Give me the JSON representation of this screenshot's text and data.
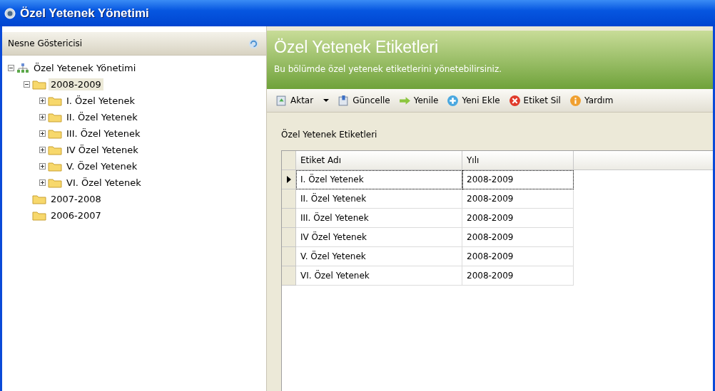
{
  "window": {
    "title": "Özel Yetenek Yönetimi"
  },
  "explorer": {
    "title": "Nesne Göstericisi",
    "tree": [
      {
        "label": "Özel Yetenek Yönetimi",
        "kind": "root",
        "expanded": true,
        "selected": false,
        "children": [
          {
            "label": "2008-2009",
            "kind": "folder",
            "expanded": true,
            "selected": true,
            "children": [
              {
                "label": "I. Özel Yetenek",
                "kind": "folder",
                "expanded": false,
                "selected": false
              },
              {
                "label": "II. Özel Yetenek",
                "kind": "folder",
                "expanded": false,
                "selected": false
              },
              {
                "label": "III. Özel Yetenek",
                "kind": "folder",
                "expanded": false,
                "selected": false
              },
              {
                "label": "IV Özel Yetenek",
                "kind": "folder",
                "expanded": false,
                "selected": false
              },
              {
                "label": "V. Özel Yetenek",
                "kind": "folder",
                "expanded": false,
                "selected": false
              },
              {
                "label": "VI. Özel Yetenek",
                "kind": "folder",
                "expanded": false,
                "selected": false
              }
            ]
          },
          {
            "label": "2007-2008",
            "kind": "folder",
            "selected": false
          },
          {
            "label": "2006-2007",
            "kind": "folder",
            "selected": false
          }
        ]
      }
    ]
  },
  "header": {
    "title": "Özel Yetenek Etiketleri",
    "subtitle": "Bu bölümde özel yetenek etiketlerini yönetebilirsiniz."
  },
  "toolbar": [
    {
      "label": "Aktar",
      "kind": "export",
      "has_menu": true
    },
    {
      "label": "Güncelle",
      "kind": "update",
      "has_menu": false
    },
    {
      "label": "Yenile",
      "kind": "refresh",
      "has_menu": false
    },
    {
      "label": "Yeni Ekle",
      "kind": "add",
      "has_menu": false
    },
    {
      "label": "Etiket Sil",
      "kind": "delete",
      "has_menu": false
    },
    {
      "label": "Yardım",
      "kind": "help",
      "has_menu": false
    }
  ],
  "group": {
    "title": "Özel Yetenek Etiketleri"
  },
  "table": {
    "columns": [
      "Etiket Adı",
      "Yılı"
    ],
    "rows": [
      {
        "cells": [
          "I. Özel Yetenek",
          "2008-2009"
        ],
        "selected": true
      },
      {
        "cells": [
          "II. Özel Yetenek",
          "2008-2009"
        ],
        "selected": false
      },
      {
        "cells": [
          "III. Özel Yetenek",
          "2008-2009"
        ],
        "selected": false
      },
      {
        "cells": [
          "IV Özel Yetenek",
          "2008-2009"
        ],
        "selected": false
      },
      {
        "cells": [
          "V. Özel Yetenek",
          "2008-2009"
        ],
        "selected": false
      },
      {
        "cells": [
          "VI. Özel Yetenek",
          "2008-2009"
        ],
        "selected": false
      }
    ]
  }
}
